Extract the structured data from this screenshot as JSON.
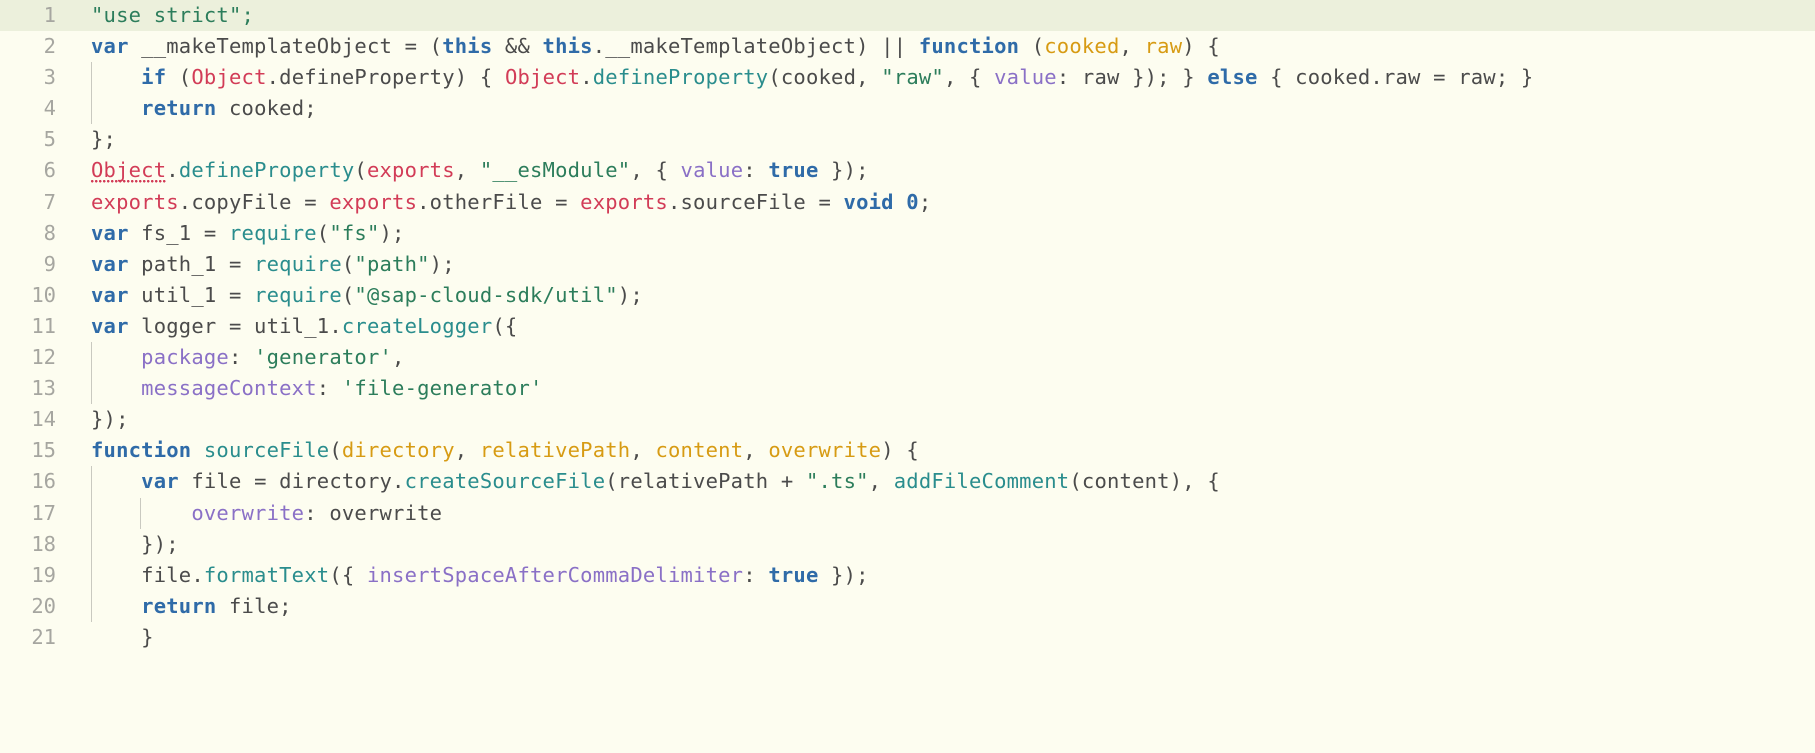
{
  "editor": {
    "language": "javascript",
    "background_color": "#fdfdf0",
    "current_line_highlight_color": "#ecf0dc",
    "gutter_color": "#a6a6a0",
    "colors": {
      "keyword": "#2f6ba8",
      "string": "#2c7d5b",
      "function": "#2a8d8d",
      "identifier": "#d23c57",
      "parameter": "#d79b13",
      "property": "#8a70c6",
      "plain": "#4b4b4b",
      "error_squiggle": "#d23c57"
    },
    "current_line": 1,
    "first_visible_line": 1,
    "last_visible_line": 21
  },
  "lines": [
    {
      "number": "1",
      "current": true,
      "indent_guides": 0
    },
    {
      "number": "2",
      "current": false,
      "indent_guides": 0
    },
    {
      "number": "3",
      "current": false,
      "indent_guides": 1
    },
    {
      "number": "4",
      "current": false,
      "indent_guides": 1
    },
    {
      "number": "5",
      "current": false,
      "indent_guides": 0
    },
    {
      "number": "6",
      "current": false,
      "indent_guides": 0
    },
    {
      "number": "7",
      "current": false,
      "indent_guides": 0
    },
    {
      "number": "8",
      "current": false,
      "indent_guides": 0
    },
    {
      "number": "9",
      "current": false,
      "indent_guides": 0
    },
    {
      "number": "10",
      "current": false,
      "indent_guides": 0
    },
    {
      "number": "11",
      "current": false,
      "indent_guides": 0
    },
    {
      "number": "12",
      "current": false,
      "indent_guides": 1
    },
    {
      "number": "13",
      "current": false,
      "indent_guides": 1
    },
    {
      "number": "14",
      "current": false,
      "indent_guides": 0
    },
    {
      "number": "15",
      "current": false,
      "indent_guides": 0
    },
    {
      "number": "16",
      "current": false,
      "indent_guides": 1
    },
    {
      "number": "17",
      "current": false,
      "indent_guides": 1
    },
    {
      "number": "18",
      "current": false,
      "indent_guides": 1
    },
    {
      "number": "19",
      "current": false,
      "indent_guides": 1
    },
    {
      "number": "20",
      "current": false,
      "indent_guides": 1
    },
    {
      "number": "21",
      "current": false,
      "indent_guides": 1
    }
  ],
  "code": {
    "line1": {
      "t1": "\"use strict\";"
    },
    "line2": {
      "t1": "var",
      "t2": " __makeTemplateObject = (",
      "t3": "this",
      "t4": " && ",
      "t5": "this",
      "t6": ".__makeTemplateObject) || ",
      "t7": "function",
      "t8": " (",
      "t9": "cooked",
      "t10": ", ",
      "t11": "raw",
      "t12": ") {"
    },
    "line3": {
      "t1": "    ",
      "t2": "if",
      "t3": " (",
      "t4": "Object",
      "t5": ".defineProperty) { ",
      "t6": "Object",
      "t7": ".",
      "t8": "defineProperty",
      "t9": "(cooked, ",
      "t10": "\"raw\"",
      "t11": ", { ",
      "t12": "value",
      "t13": ": raw }); } ",
      "t14": "else",
      "t15": " { cooked.raw = raw; }"
    },
    "line4": {
      "t1": "    ",
      "t2": "return",
      "t3": " cooked;"
    },
    "line5": {
      "t1": "};"
    },
    "line6": {
      "t1": "Object",
      "t2": ".",
      "t3": "defineProperty",
      "t4": "(",
      "t5": "exports",
      "t6": ", ",
      "t7": "\"__esModule\"",
      "t8": ", { ",
      "t9": "value",
      "t10": ": ",
      "t11": "true",
      "t12": " });"
    },
    "line7": {
      "t1": "exports",
      "t2": ".copyFile = ",
      "t3": "exports",
      "t4": ".otherFile = ",
      "t5": "exports",
      "t6": ".sourceFile = ",
      "t7": "void",
      "t8": " ",
      "t9": "0",
      "t10": ";"
    },
    "line8": {
      "t1": "var",
      "t2": " fs_1 = ",
      "t3": "require",
      "t4": "(",
      "t5": "\"fs\"",
      "t6": ");"
    },
    "line9": {
      "t1": "var",
      "t2": " path_1 = ",
      "t3": "require",
      "t4": "(",
      "t5": "\"path\"",
      "t6": ");"
    },
    "line10": {
      "t1": "var",
      "t2": " util_1 = ",
      "t3": "require",
      "t4": "(",
      "t5": "\"@sap-cloud-sdk/util\"",
      "t6": ");"
    },
    "line11": {
      "t1": "var",
      "t2": " logger = util_1.",
      "t3": "createLogger",
      "t4": "({"
    },
    "line12": {
      "t1": "    ",
      "t2": "package",
      "t3": ": ",
      "t4": "'generator'",
      "t5": ","
    },
    "line13": {
      "t1": "    ",
      "t2": "messageContext",
      "t3": ": ",
      "t4": "'file-generator'"
    },
    "line14": {
      "t1": "});"
    },
    "line15": {
      "t1": "function",
      "t2": " ",
      "t3": "sourceFile",
      "t4": "(",
      "t5": "directory",
      "t6": ", ",
      "t7": "relativePath",
      "t8": ", ",
      "t9": "content",
      "t10": ", ",
      "t11": "overwrite",
      "t12": ") {"
    },
    "line16": {
      "t1": "    ",
      "t2": "var",
      "t3": " file = directory.",
      "t4": "createSourceFile",
      "t5": "(relativePath + ",
      "t6": "\".ts\"",
      "t7": ", ",
      "t8": "addFileComment",
      "t9": "(content), {"
    },
    "line17": {
      "t1": "        ",
      "t2": "overwrite",
      "t3": ": overwrite"
    },
    "line18": {
      "t1": "    ",
      "t2": "});"
    },
    "line19": {
      "t1": "    file.",
      "t2": "formatText",
      "t3": "({ ",
      "t4": "insertSpaceAfterCommaDelimiter",
      "t5": ": ",
      "t6": "true",
      "t7": " });"
    },
    "line20": {
      "t1": "    ",
      "t2": "return",
      "t3": " file;"
    },
    "line21": {
      "t1": "    }"
    }
  }
}
